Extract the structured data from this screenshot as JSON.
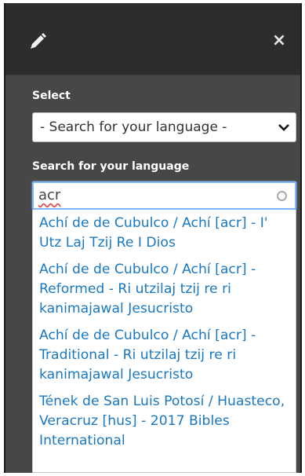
{
  "header": {
    "edit_icon": "pencil-icon",
    "close_label": "×"
  },
  "select": {
    "label": "Select",
    "value": "- Search for your language -"
  },
  "search": {
    "label": "Search for your language",
    "value": "acr"
  },
  "results": [
    "Achí de de Cubulco / Achí [acr] - I' Utz Laj Tzij Re I Dios",
    "Achí de de Cubulco / Achí [acr] - Reformed - Ri utzilaj tzij re ri kanimajawal Jesucristo",
    "Achí de de Cubulco / Achí [acr] - Traditional - Ri utzilaj tzij re ri kanimajawal Jesucristo",
    "Tének de San Luis Potosí / Huasteco, Veracruz [hus] - 2017 Bibles International"
  ],
  "colors": {
    "panel": "#474747",
    "header": "#2d2d2d",
    "link": "#1a78c2",
    "focus_border": "#7db8ff"
  }
}
